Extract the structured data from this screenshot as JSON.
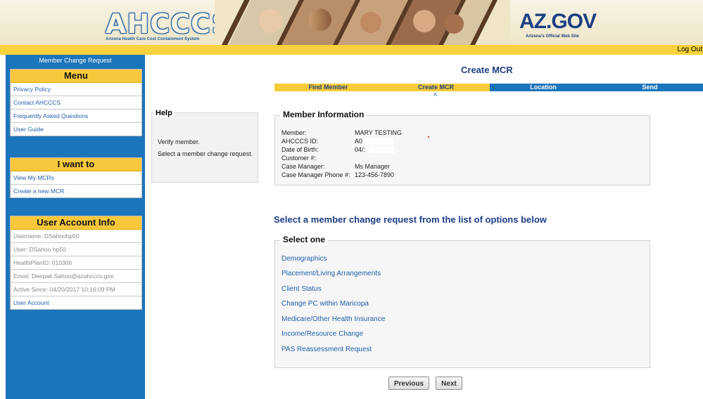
{
  "banner": {
    "logo_text": "AHCCCS",
    "logo_subtitle": "Arizona Health Care Cost Containment System",
    "azgov_text": "AZ.GOV",
    "azgov_subtitle": "Arizona's Official Web Site"
  },
  "header": {
    "logout_label": "Log Out"
  },
  "sidebar": {
    "title": "Member Change Request",
    "menu": {
      "heading": "Menu",
      "items": [
        "Privacy Policy",
        "Contact AHCCCS",
        "Frequently Asked Questions",
        "User Guide"
      ]
    },
    "iwant": {
      "heading": "I want to",
      "items": [
        "View My MCRs",
        "Create a new MCR"
      ]
    },
    "account": {
      "heading": "User Account Info",
      "items": [
        "Username: DSahoohp50",
        "User: DSahoo hp50",
        "HealthPlanID: 010306",
        "Email: Deepak.Sahoo@azahcccs.gov",
        "Active Since: 04/20/2017 10:16:09 PM"
      ],
      "link": "User Account"
    }
  },
  "help": {
    "title": "Help",
    "line1": "Verify member.",
    "line2": "Select a member change request."
  },
  "main": {
    "title": "Create MCR",
    "steps": [
      {
        "label": "Find Member",
        "state": "done"
      },
      {
        "label": "Create MCR",
        "state": "current"
      },
      {
        "label": "Location",
        "state": "todo"
      },
      {
        "label": "Send",
        "state": "todo"
      }
    ],
    "step_indicator": "^",
    "member_info": {
      "legend": "Member Information",
      "fields": [
        {
          "label": "Member:",
          "value": "MARY TESTING"
        },
        {
          "label": "AHCCCS ID:",
          "value": "A0"
        },
        {
          "label": "Date of Birth:",
          "value": "04/:"
        },
        {
          "label": "Customer #:",
          "value": ""
        },
        {
          "label": "Case Manager:",
          "value": "Ms Manager"
        },
        {
          "label": "Case Manager Phone #:",
          "value": "123-456-7890"
        }
      ]
    },
    "select_title": "Select a member change request from the list of options below",
    "select_box": {
      "legend": "Select one",
      "options": [
        "Demographics",
        "Placement/Living Arrangements",
        "Client Status",
        "Change PC within Maricopa",
        "Medicare/Other Health Insurance",
        "Income/Resource Change",
        "PAS Reassessment Request"
      ]
    },
    "buttons": {
      "previous": "Previous",
      "next": "Next"
    }
  },
  "colors": {
    "sidebar_blue": "#1b75bb",
    "accent_yellow": "#f6cc38",
    "heading_navy": "#1b3e86",
    "link_blue": "#1f5fa8"
  }
}
